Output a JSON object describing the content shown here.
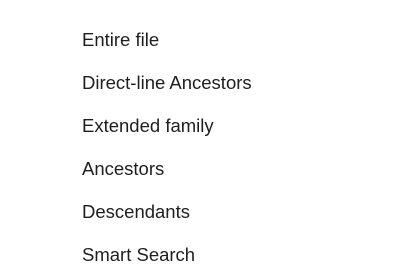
{
  "menu": {
    "items": [
      {
        "label": "Entire file"
      },
      {
        "label": "Direct-line Ancestors"
      },
      {
        "label": "Extended family"
      },
      {
        "label": "Ancestors"
      },
      {
        "label": "Descendants"
      },
      {
        "label": "Smart Search"
      }
    ]
  }
}
